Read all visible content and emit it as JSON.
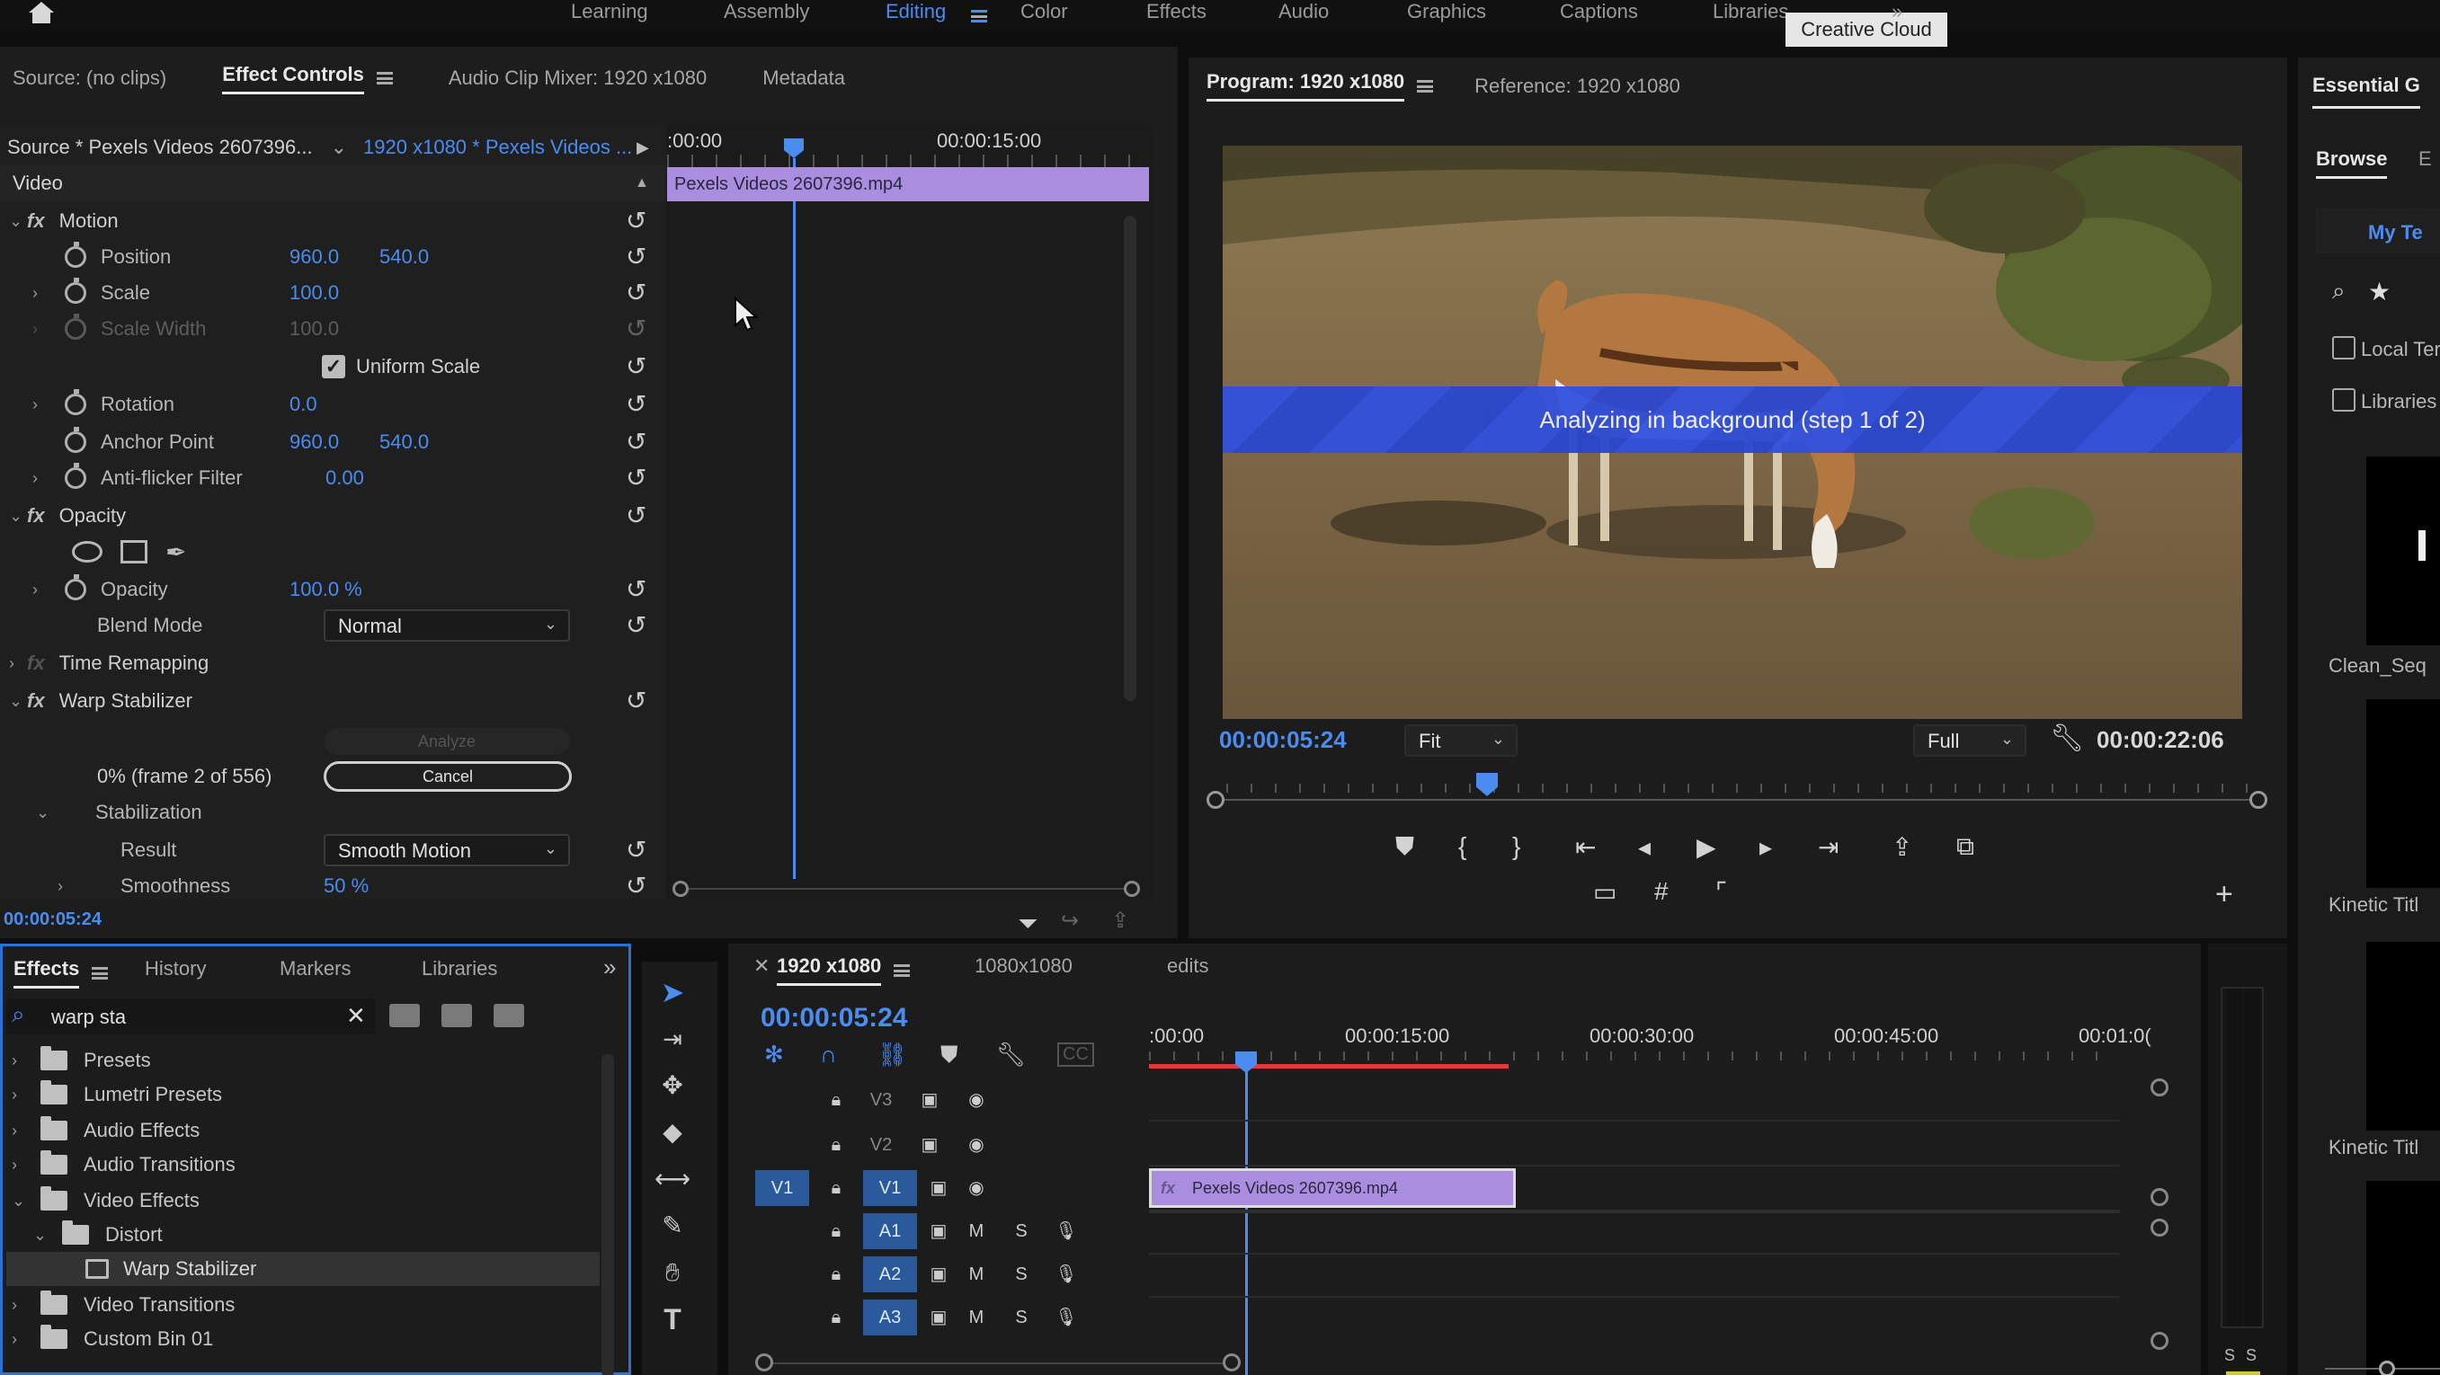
{
  "workspaces": {
    "items": [
      "Learning",
      "Assembly",
      "Editing",
      "Color",
      "Effects",
      "Audio",
      "Graphics",
      "Captions",
      "Libraries"
    ],
    "active": "Editing",
    "tooltip": "Creative Cloud"
  },
  "source_panel": {
    "tabs": [
      "Source: (no clips)",
      "Effect Controls",
      "Audio Clip Mixer: 1920 x1080",
      "Metadata"
    ],
    "source_label": "Source * Pexels Videos 2607396...",
    "sequence_label": "1920 x1080 * Pexels Videos ...",
    "video_header": "Video",
    "motion": {
      "label": "Motion",
      "position": {
        "label": "Position",
        "x": "960.0",
        "y": "540.0"
      },
      "scale": {
        "label": "Scale",
        "value": "100.0"
      },
      "scale_width": {
        "label": "Scale Width",
        "value": "100.0"
      },
      "uniform_scale": {
        "label": "Uniform Scale",
        "checked": true
      },
      "rotation": {
        "label": "Rotation",
        "value": "0.0"
      },
      "anchor_point": {
        "label": "Anchor Point",
        "x": "960.0",
        "y": "540.0"
      },
      "anti_flicker": {
        "label": "Anti-flicker Filter",
        "value": "0.00"
      }
    },
    "opacity": {
      "label": "Opacity",
      "opacity_value": {
        "label": "Opacity",
        "value": "100.0 %"
      },
      "blend_mode": {
        "label": "Blend Mode",
        "value": "Normal"
      }
    },
    "time_remapping": "Time Remapping",
    "warp_stabilizer": {
      "label": "Warp Stabilizer",
      "analyze_button": "Analyze",
      "progress": "0% (frame 2 of 556)",
      "cancel_button": "Cancel",
      "stabilization": "Stabilization",
      "result": {
        "label": "Result",
        "value": "Smooth Motion"
      },
      "smoothness": {
        "label": "Smoothness",
        "value": "50 %"
      }
    },
    "timecode": "00:00:05:24",
    "mini_timeline": {
      "start": ":00:00",
      "mark": "00:00:15:00",
      "clip": "Pexels Videos 2607396.mp4"
    }
  },
  "program_monitor": {
    "tabs": [
      "Program: 1920 x1080",
      "Reference: 1920 x1080"
    ],
    "overlay_text": "Analyzing in background (step 1 of 2)",
    "timecode_current": "00:00:05:24",
    "zoom": "Fit",
    "quality": "Full",
    "timecode_duration": "00:00:22:06"
  },
  "essential_graphics": {
    "title": "Essential G",
    "tabs": [
      "Browse",
      "E"
    ],
    "my_templates": "My Te",
    "checkboxes": [
      "Local Ter",
      "Libraries"
    ],
    "templates": [
      "Clean_Seq",
      "Kinetic Titl",
      "Kinetic Titl"
    ]
  },
  "effects_panel": {
    "tabs": [
      "Effects",
      "History",
      "Markers",
      "Libraries"
    ],
    "search_value": "warp sta",
    "tree": [
      {
        "label": "Presets",
        "level": 0,
        "expanded": false
      },
      {
        "label": "Lumetri Presets",
        "level": 0,
        "expanded": false
      },
      {
        "label": "Audio Effects",
        "level": 0,
        "expanded": false
      },
      {
        "label": "Audio Transitions",
        "level": 0,
        "expanded": false
      },
      {
        "label": "Video Effects",
        "level": 0,
        "expanded": true
      },
      {
        "label": "Distort",
        "level": 1,
        "expanded": true
      },
      {
        "label": "Warp Stabilizer",
        "level": 2,
        "selected": true
      },
      {
        "label": "Video Transitions",
        "level": 0,
        "expanded": false
      },
      {
        "label": "Custom Bin 01",
        "level": 0,
        "expanded": false
      }
    ]
  },
  "timeline": {
    "tabs": [
      "1920 x1080",
      "1080x1080",
      "edits"
    ],
    "timecode": "00:00:05:24",
    "ruler": [
      ":00:00",
      "00:00:15:00",
      "00:00:30:00",
      "00:00:45:00",
      "00:01:0("
    ],
    "video_tracks": [
      "V3",
      "V2",
      "V1"
    ],
    "audio_tracks": [
      "A1",
      "A2",
      "A3"
    ],
    "source_patch": "V1",
    "track_buttons": {
      "mute": "M",
      "solo": "S"
    },
    "clip": "Pexels Videos 2607396.mp4",
    "meter_labels": [
      "S",
      "S"
    ]
  },
  "colors": {
    "accent": "#4a8cf0",
    "clip": "#a98ee0",
    "overlay": "#2f4fd8",
    "work_area": "#e03a3a"
  }
}
